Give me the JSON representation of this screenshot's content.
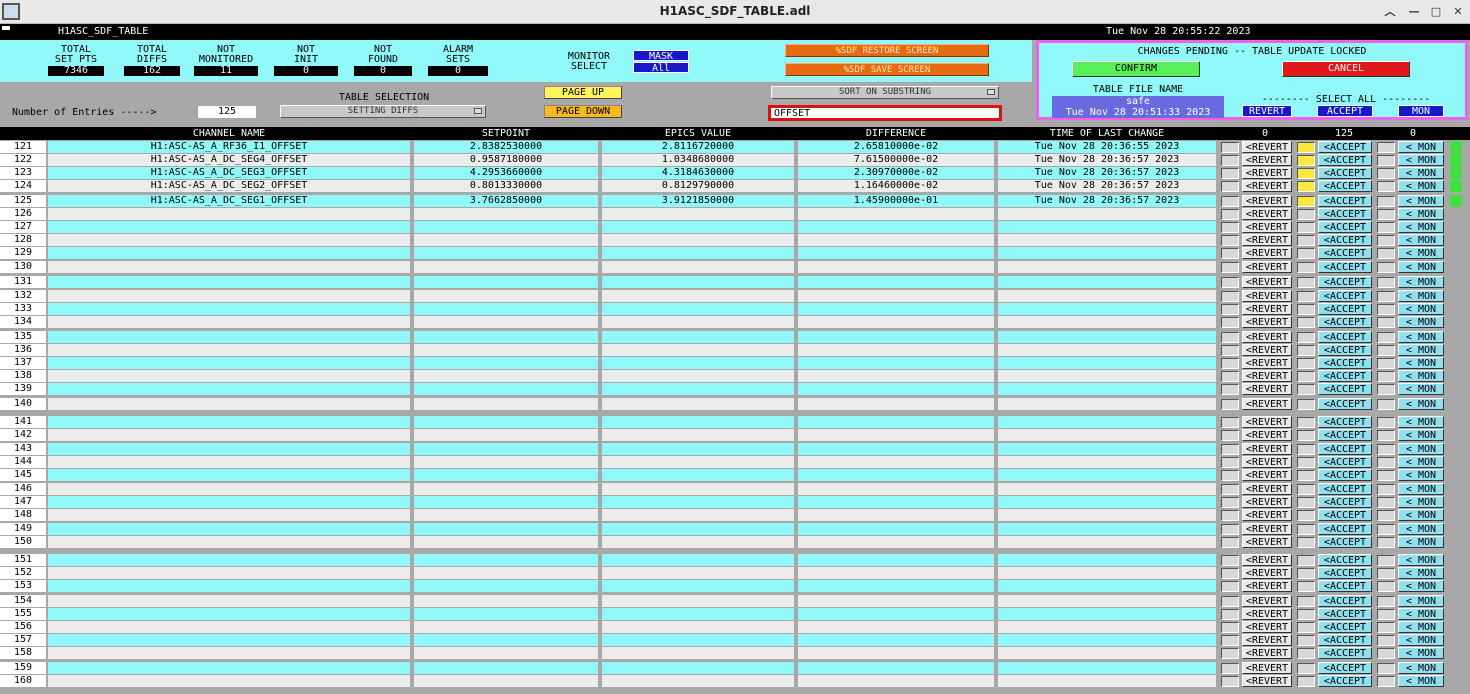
{
  "window": {
    "title": "H1ASC_SDF_TABLE.adl"
  },
  "header": {
    "screen_name": "H1ASC_SDF_TABLE",
    "timestamp": "Tue Nov 28 20:55:22 2023"
  },
  "counters": [
    {
      "label": "TOTAL\nSET PTS",
      "value": "7346"
    },
    {
      "label": "TOTAL\nDIFFS",
      "value": "162"
    },
    {
      "label": "NOT\nMONITORED",
      "value": "11"
    },
    {
      "label": "NOT\nINIT",
      "value": "0"
    },
    {
      "label": "NOT\nFOUND",
      "value": "0"
    },
    {
      "label": "ALARM\nSETS",
      "value": "0"
    }
  ],
  "monitor": {
    "label": "MONITOR\nSELECT",
    "mask": "MASK",
    "all": "All"
  },
  "buttons": {
    "restore": "%SDF RESTORE SCREEN",
    "save": "%SDF SAVE SCREEN",
    "page_up": "PAGE UP",
    "page_down": "PAGE DOWN",
    "sort": "SORT ON SUBSTRING",
    "confirm": "CONFIRM",
    "cancel": "CANCEL",
    "revert_all": "REVERT",
    "accept_all": "ACCEPT",
    "mon_all": "MON"
  },
  "controls": {
    "entries_label": "Number of Entries ----->",
    "entries_value": "125",
    "table_selection_label": "TABLE SELECTION",
    "table_selection_value": "SETTING DIFFS",
    "substring": "OFFSET"
  },
  "pending": {
    "status": "CHANGES PENDING -- TABLE UPDATE LOCKED",
    "file_label": "TABLE FILE NAME",
    "file_name": "safe",
    "file_time": "Tue Nov 28 20:51:33 2023",
    "select_all": "-------- SELECT ALL --------"
  },
  "columns": {
    "channel": "CHANNEL NAME",
    "setpoint": "SETPOINT",
    "epics": "EPICS VALUE",
    "difference": "DIFFERENCE",
    "time": "TIME OF LAST CHANGE",
    "count_revert": "0",
    "count_accept": "125",
    "count_mon": "0"
  },
  "row_buttons": {
    "revert": "<REVERT",
    "accept": "<ACCEPT",
    "mon": "< MON"
  },
  "rows": [
    {
      "n": "121",
      "channel": "H1:ASC-AS_A_RF36_I1_OFFSET",
      "setpoint": "2.8382530000",
      "epics": "2.8116720000",
      "diff": "2.65810000e-02",
      "time": "Tue Nov 28 20:36:55 2023",
      "accept": true
    },
    {
      "n": "122",
      "channel": "H1:ASC-AS_A_DC_SEG4_OFFSET",
      "setpoint": "0.9587180000",
      "epics": "1.0348680000",
      "diff": "7.61500000e-02",
      "time": "Tue Nov 28 20:36:57 2023",
      "accept": true
    },
    {
      "n": "123",
      "channel": "H1:ASC-AS_A_DC_SEG3_OFFSET",
      "setpoint": "4.2953660000",
      "epics": "4.3184630000",
      "diff": "2.30970000e-02",
      "time": "Tue Nov 28 20:36:57 2023",
      "accept": true
    },
    {
      "n": "124",
      "channel": "H1:ASC-AS_A_DC_SEG2_OFFSET",
      "setpoint": "0.8013330000",
      "epics": "0.8129790000",
      "diff": "1.16460000e-02",
      "time": "Tue Nov 28 20:36:57 2023",
      "accept": true
    },
    {
      "n": "125",
      "channel": "H1:ASC-AS_A_DC_SEG1_OFFSET",
      "setpoint": "3.7662850000",
      "epics": "3.9121850000",
      "diff": "1.45900000e-01",
      "time": "Tue Nov 28 20:36:57 2023",
      "accept": true
    },
    {
      "n": "126"
    },
    {
      "n": "127"
    },
    {
      "n": "128"
    },
    {
      "n": "129"
    },
    {
      "n": "130"
    },
    {
      "n": "131"
    },
    {
      "n": "132"
    },
    {
      "n": "133"
    },
    {
      "n": "134"
    },
    {
      "n": "135"
    },
    {
      "n": "136"
    },
    {
      "n": "137"
    },
    {
      "n": "138"
    },
    {
      "n": "139"
    },
    {
      "n": "140"
    },
    {
      "n": "141"
    },
    {
      "n": "142"
    },
    {
      "n": "143"
    },
    {
      "n": "144"
    },
    {
      "n": "145"
    },
    {
      "n": "146"
    },
    {
      "n": "147"
    },
    {
      "n": "148"
    },
    {
      "n": "149"
    },
    {
      "n": "150"
    },
    {
      "n": "151"
    },
    {
      "n": "152"
    },
    {
      "n": "153"
    },
    {
      "n": "154"
    },
    {
      "n": "155"
    },
    {
      "n": "156"
    },
    {
      "n": "157"
    },
    {
      "n": "158"
    },
    {
      "n": "159"
    },
    {
      "n": "160"
    }
  ]
}
